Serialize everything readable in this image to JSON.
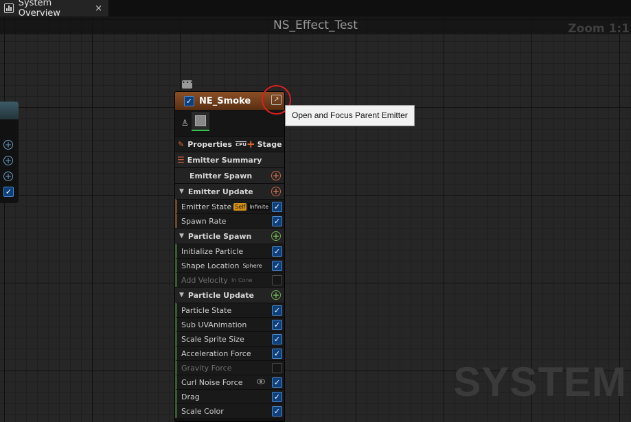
{
  "tab": {
    "label": "System Overview",
    "icon": "chart-icon",
    "close": "×"
  },
  "graph": {
    "title": "NS_Effect_Test",
    "zoom": "Zoom 1:1",
    "watermark": "SYSTEM"
  },
  "node": {
    "title": "NE_Smoke",
    "enabled": true,
    "open_tooltip": "Open and Focus Parent Emitter",
    "toolbar": {
      "properties": "Properties",
      "sim_target": "CPU",
      "stage": "Stage"
    },
    "summary": "Emitter Summary",
    "emitter_spawn": "Emitter Spawn",
    "sections": [
      {
        "label": "Emitter Update",
        "modules": [
          {
            "label": "Emitter State",
            "tags": [
              "Self",
              "Infinite"
            ],
            "enabled": true
          },
          {
            "label": "Spawn Rate",
            "enabled": true
          }
        ]
      },
      {
        "label": "Particle Spawn",
        "modules": [
          {
            "label": "Initialize Particle",
            "enabled": true
          },
          {
            "label": "Shape Location",
            "tag": "Sphere",
            "enabled": true
          },
          {
            "label": "Add Velocity",
            "tag": "In Cone",
            "enabled": false
          }
        ]
      },
      {
        "label": "Particle Update",
        "modules": [
          {
            "label": "Particle State",
            "enabled": true
          },
          {
            "label": "Sub UVAnimation",
            "enabled": true
          },
          {
            "label": "Scale Sprite Size",
            "enabled": true
          },
          {
            "label": "Acceleration Force",
            "enabled": true
          },
          {
            "label": "Gravity Force",
            "enabled": false
          },
          {
            "label": "Curl Noise Force",
            "enabled": true
          },
          {
            "label": "Drag",
            "enabled": true
          },
          {
            "label": "Scale Color",
            "enabled": true
          }
        ]
      }
    ]
  },
  "colors": {
    "highlight": "#e01d1d",
    "node_header": "#8a4f26",
    "checkbox": "#0d3f7c"
  }
}
